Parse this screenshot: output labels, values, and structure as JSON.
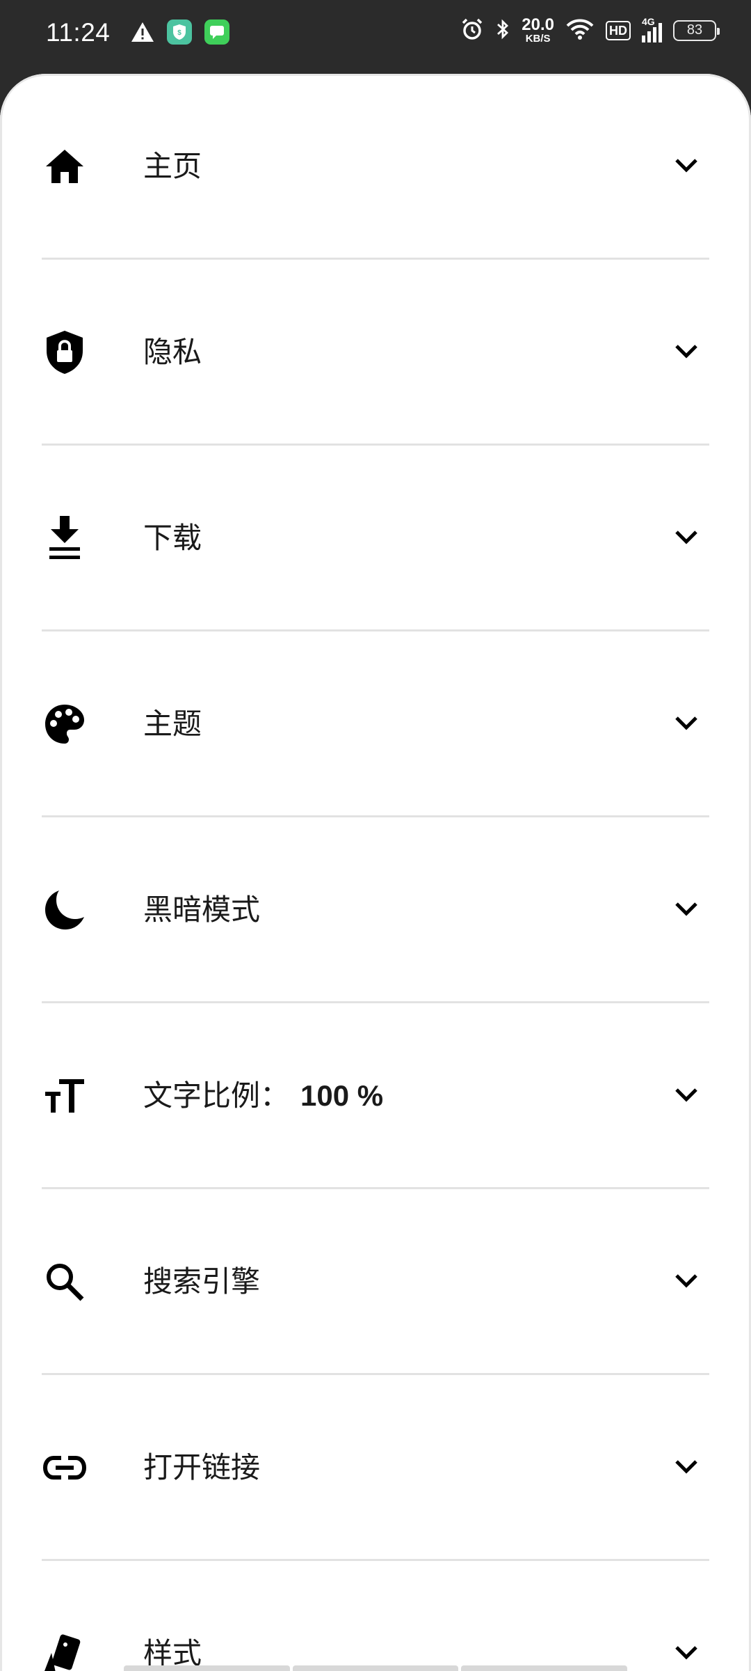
{
  "status_bar": {
    "time": "11:24",
    "net_speed_value": "20.0",
    "net_speed_unit": "KB/S",
    "hd_label": "HD",
    "network_type": "4G",
    "battery": "83"
  },
  "settings": [
    {
      "label": "主页",
      "icon": "home-icon"
    },
    {
      "label": "隐私",
      "icon": "shield-lock-icon"
    },
    {
      "label": "下载",
      "icon": "download-icon"
    },
    {
      "label": "主题",
      "icon": "palette-icon"
    },
    {
      "label": "黑暗模式",
      "icon": "moon-icon"
    },
    {
      "label": "文字比例：",
      "value": "100 %",
      "icon": "text-size-icon"
    },
    {
      "label": "搜索引擎",
      "icon": "search-icon"
    },
    {
      "label": "打开链接",
      "icon": "link-icon"
    },
    {
      "label": "样式",
      "icon": "style-cards-icon"
    }
  ]
}
